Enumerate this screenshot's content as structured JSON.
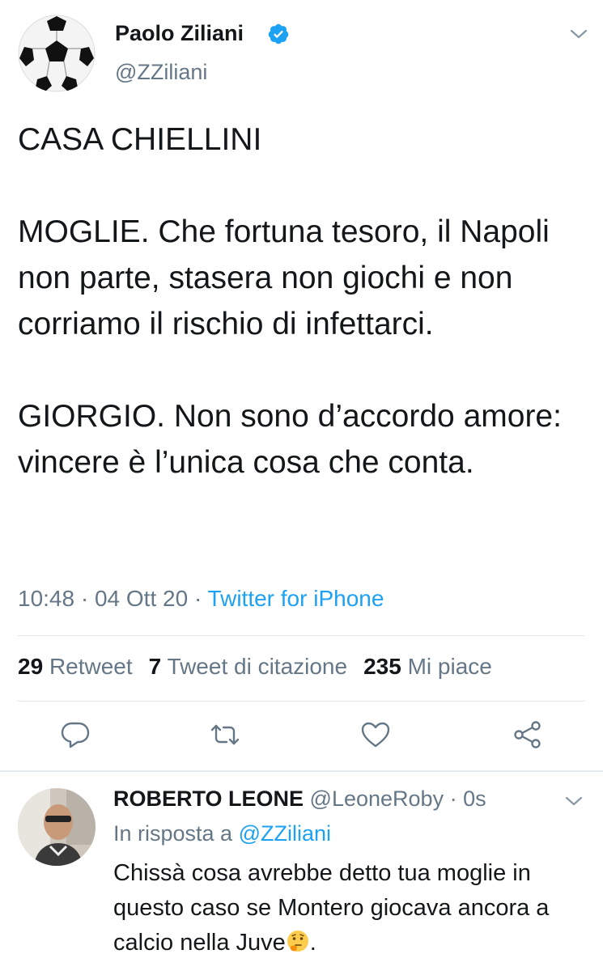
{
  "tweet": {
    "author_name": "Paolo Ziliani",
    "author_handle": "@ZZiliani",
    "verified_icon": "verified-badge-icon",
    "body": "CASA CHIELLINI\n\nMOGLIE. Che fortuna tesoro, il Napoli non parte, stasera non giochi e non corriamo il rischio di infettarci.\n\nGIORGIO. Non sono d’accordo amore: vincere è l’unica cosa che conta.",
    "time": "10:48",
    "date": "04 Ott 20",
    "separator": "·",
    "source": "Twitter for iPhone",
    "stats": {
      "retweets_count": "29",
      "retweets_label": "Retweet",
      "quotes_count": "7",
      "quotes_label": "Tweet di citazione",
      "likes_count": "235",
      "likes_label": "Mi piace"
    },
    "actions": [
      "reply-icon",
      "retweet-icon",
      "like-icon",
      "share-icon"
    ]
  },
  "reply": {
    "author_name": "ROBERTO LEONE",
    "author_handle": "@LeoneRoby",
    "separator": "·",
    "time": "0s",
    "in_reply_to_label": "In risposta a",
    "in_reply_to_handle": "@ZZiliani",
    "text_before_emoji": "Chissà cosa avrebbe detto tua moglie in questo caso se Montero giocava ancora a calcio nella Juve",
    "text_after_emoji": ".",
    "emoji_icon": "thinking-face-icon"
  },
  "colors": {
    "accent": "#1da1f2",
    "text": "#14171a",
    "secondary": "#657786",
    "divider": "#e1e8ed"
  }
}
